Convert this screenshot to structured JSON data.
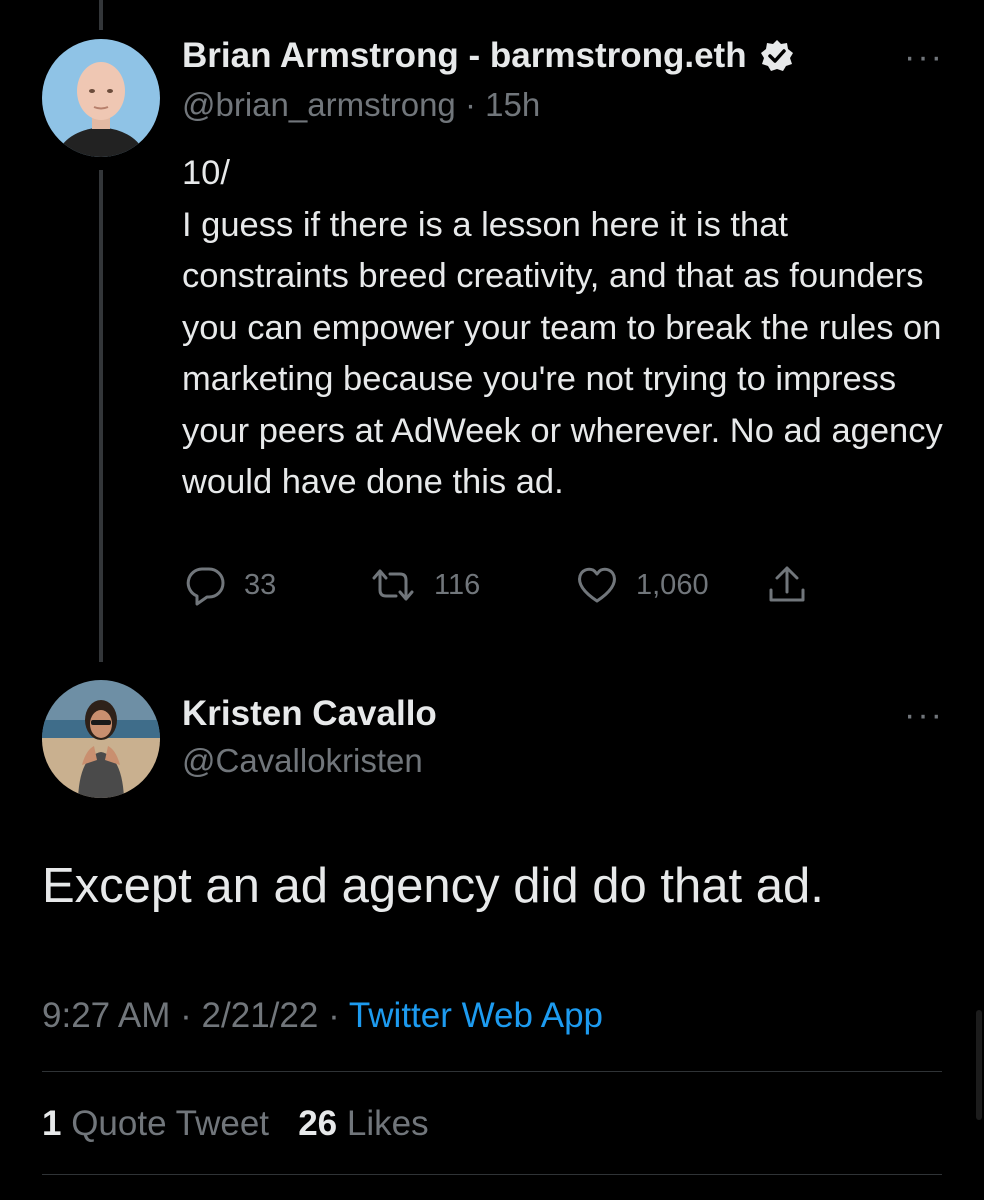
{
  "tweet1": {
    "author_name": "Brian Armstrong - barmstrong.eth",
    "handle": "@brian_armstrong",
    "separator": "·",
    "time_ago": "15h",
    "text": "10/\nI guess if there is a lesson here it is that constraints breed creativity, and that as founders you can empower your team to break the rules on marketing because you're not trying to impress your peers at AdWeek or wherever. No ad agency would have done this ad.",
    "replies": "33",
    "retweets": "116",
    "likes": "1,060",
    "more_label": "···"
  },
  "tweet2": {
    "author_name": "Kristen Cavallo",
    "handle": "@Cavallokristen",
    "text": "Except an ad agency did do that ad.",
    "time": "9:27 AM",
    "separator": "·",
    "date": "2/21/22",
    "source": "Twitter Web App",
    "quote_count": "1",
    "quote_label": "Quote Tweet",
    "like_count": "26",
    "like_label": "Likes",
    "more_label": "···"
  },
  "icons": {
    "verified": "verified-badge-icon",
    "reply": "reply-icon",
    "retweet": "retweet-icon",
    "like": "heart-icon",
    "share": "share-icon"
  },
  "colors": {
    "background": "#000000",
    "text": "#e7e9ea",
    "secondary": "#71767b",
    "link": "#1d9bf0"
  }
}
